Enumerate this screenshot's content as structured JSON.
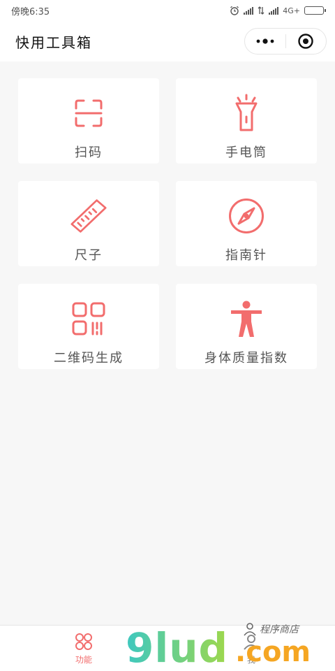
{
  "status_bar": {
    "time": "傍晚6:35",
    "network": "4G+"
  },
  "nav": {
    "title": "快用工具箱"
  },
  "tools": [
    {
      "label": "扫码",
      "icon": "scan-icon"
    },
    {
      "label": "手电筒",
      "icon": "flashlight-icon"
    },
    {
      "label": "尺子",
      "icon": "ruler-icon"
    },
    {
      "label": "指南针",
      "icon": "compass-icon"
    },
    {
      "label": "二维码生成",
      "icon": "qrcode-icon"
    },
    {
      "label": "身体质量指数",
      "icon": "person-icon"
    }
  ],
  "tab_bar": {
    "tabs": [
      {
        "label": "功能",
        "active": true,
        "icon": "grid-circles-icon"
      },
      {
        "label": "我",
        "active": false,
        "icon": "user-icon"
      }
    ]
  },
  "watermark": {
    "brand": "9lud",
    "suffix": ".com",
    "tagline": "程序商店"
  },
  "colors": {
    "accent": "#f26d6d",
    "background": "#f7f7f7",
    "card": "#ffffff"
  }
}
